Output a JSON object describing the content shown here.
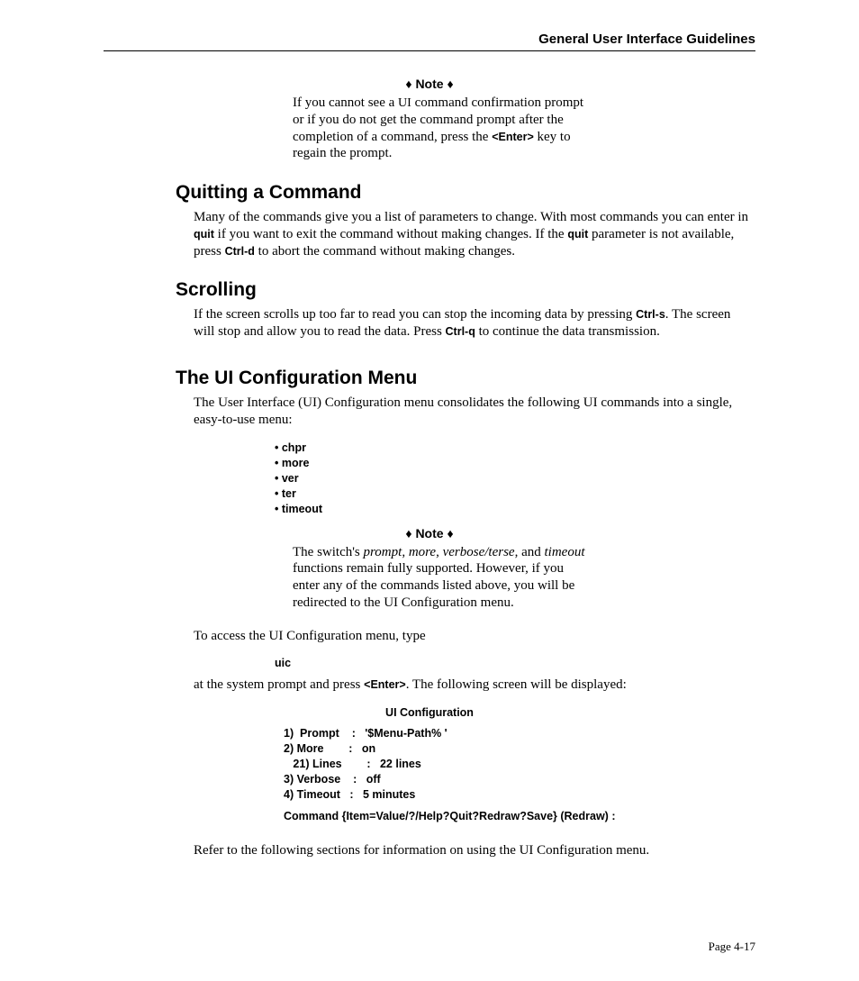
{
  "header": {
    "running": "General User Interface Guidelines"
  },
  "note1": {
    "label": "♦ Note ♦",
    "text": "If you cannot see a UI command confirmation prompt or if you do not get the command prompt after the completion of a command, press the <Enter> key to regain the prompt."
  },
  "sec1": {
    "title": "Quitting a Command",
    "body_pre": "Many of the commands give you a list of parameters to change. With most commands you can enter in ",
    "quit": "quit",
    "body_mid": " if you want to exit the command without making changes. If the ",
    "body_mid2": " parameter is not available, press ",
    "ctrld": "Ctrl-d",
    "body_post": " to abort the command without making changes."
  },
  "sec2": {
    "title": "Scrolling",
    "body_pre": "If the screen scrolls up too far to read you can stop the incoming data by pressing ",
    "ctrls": "Ctrl-s",
    "body_mid": ". The screen will stop and allow you to read the data. Press ",
    "ctrlq": "Ctrl-q",
    "body_post": " to continue the data transmission."
  },
  "sec3": {
    "title": "The UI Configuration Menu",
    "intro": "The User Interface (UI) Configuration menu consolidates the following UI commands into a single, easy-to-use menu:",
    "cmds": [
      "chpr",
      "more",
      "ver",
      "ter",
      "timeout"
    ],
    "note": {
      "label": "♦ Note ♦",
      "pre": "The switch's ",
      "i1": "prompt",
      "c1": ", ",
      "i2": "more",
      "c2": ", ",
      "i3": "verbose/terse",
      "c3": ", and ",
      "i4": "timeout",
      "post": " functions remain fully supported. However, if you enter any of the commands listed above, you will be redirected to the UI Configuration menu."
    },
    "access": "To access the UI Configuration menu, type",
    "uic": "uic",
    "after_pre": "at the system prompt and press ",
    "enter": "<Enter>",
    "after_post": ". The following screen will be displayed:",
    "screen_title": "UI Configuration",
    "screen": "1)  Prompt    :   '$Menu-Path% '\n2) More        :   on\n   21) Lines        :   22 lines\n3) Verbose    :   off\n4) Timeout   :   5 minutes",
    "screen_cmd": "Command {Item=Value/?/Help?Quit?Redraw?Save} (Redraw)   :",
    "refer": "Refer to the following sections for information on using the UI Configuration menu."
  },
  "pagenum": "Page 4-17"
}
